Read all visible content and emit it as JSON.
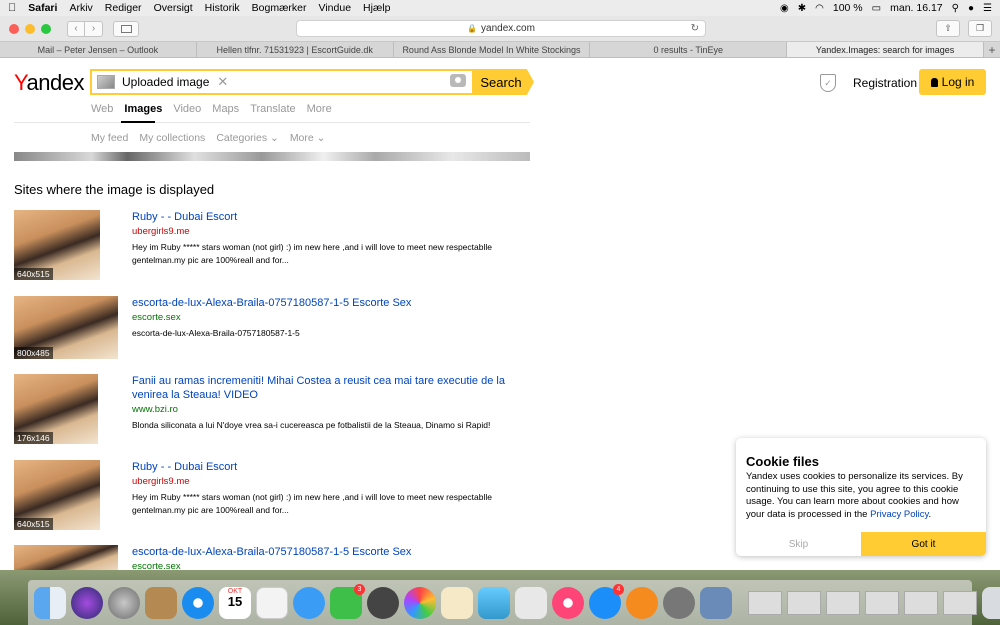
{
  "menubar": {
    "items": [
      "Safari",
      "Arkiv",
      "Rediger",
      "Oversigt",
      "Historik",
      "Bogmærker",
      "Vindue",
      "Hjælp"
    ],
    "battery": "100 %",
    "clock": "man. 16.17"
  },
  "browser": {
    "url": "yandex.com",
    "tabs": [
      "Mail – Peter Jensen – Outlook",
      "Hellen tlfnr. 71531923 | EscortGuide.dk",
      "Round Ass Blonde Model In White Stockings",
      "0 results - TinEye",
      "Yandex.Images: search for images"
    ]
  },
  "header": {
    "logo": "Yandex",
    "search_value": "Uploaded image",
    "search_button": "Search",
    "registration": "Registration",
    "login": "Log in"
  },
  "services": [
    "Web",
    "Images",
    "Video",
    "Maps",
    "Translate",
    "More"
  ],
  "subnav": [
    "My feed",
    "My collections",
    "Categories ⌄",
    "More ⌄"
  ],
  "section_title": "Sites where the image is displayed",
  "results": [
    {
      "title": "Ruby - - Dubai Escort",
      "domain": "ubergirls9.me",
      "snippet": "Hey im Ruby ***** stars woman (not girl) :) im new here ,and i will love to meet new respectablle gentelman.my pic are 100%reall and for...",
      "size": "640x515"
    },
    {
      "title": "escorta-de-lux-Alexa-Braila-0757180587-1-5 Escorte Sex",
      "domain": "escorte.sex",
      "snippet": "escorta-de-lux-Alexa-Braila-0757180587-1-5",
      "size": "800x485"
    },
    {
      "title": "Fanii au ramas incremeniti! Mihai Costea a reusit cea mai tare executie de la venirea la Steaua! VIDEO",
      "domain": "www.bzi.ro",
      "snippet": "Blonda siliconata a lui N'doye vrea sa-i cucereasca pe fotbalistii de la Steaua, Dinamo si Rapid!",
      "size": "176x146"
    },
    {
      "title": "Ruby - - Dubai Escort",
      "domain": "ubergirls9.me",
      "snippet": "Hey im Ruby ***** stars woman (not girl) :) im new here ,and i will love to meet new respectablle gentelman.my pic are 100%reall and for...",
      "size": "640x515"
    },
    {
      "title": "escorta-de-lux-Alexa-Braila-0757180587-1-5 Escorte Sex",
      "domain": "escorte.sex",
      "snippet": "",
      "size": ""
    }
  ],
  "cookie": {
    "title": "Cookie files",
    "text": "Yandex uses cookies to personalize its services. By continuing to use this site, you agree to this cookie usage. You can learn more about cookies and how your data is processed in the",
    "link": "Privacy Policy",
    "end": ".",
    "skip": "Skip",
    "accept": "Got it"
  },
  "dock": {
    "calendar_month": "OKT",
    "calendar_day": "15",
    "badges": [
      "3",
      "4"
    ]
  }
}
